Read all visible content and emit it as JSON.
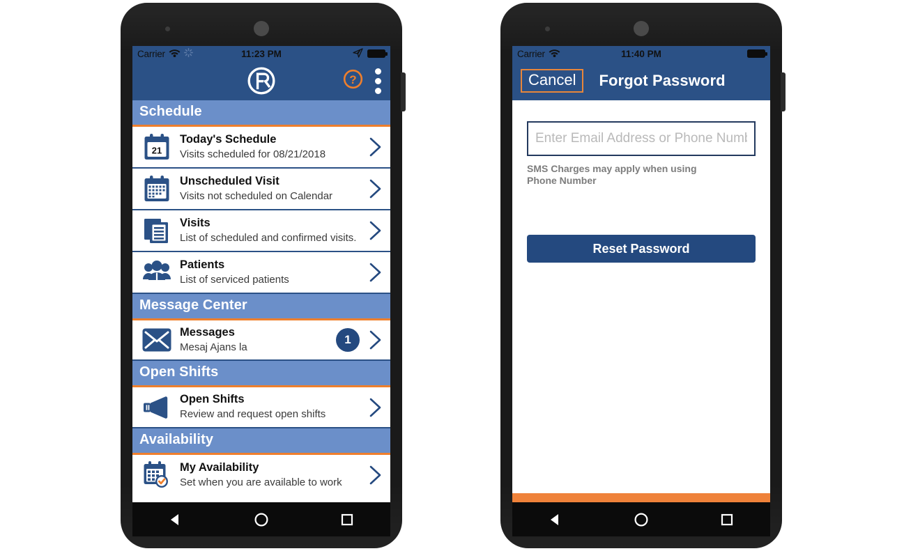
{
  "meta": {
    "colors": {
      "brand_blue": "#2b5186",
      "section_blue": "#6b8fc9",
      "accent_orange": "#ef7f2c",
      "button_blue": "#24497f",
      "screen_white": "#ffffff",
      "phone_body": "#1a1a1a"
    }
  },
  "phone_left": {
    "status_bar": {
      "carrier": "Carrier",
      "time": "11:23 PM",
      "wifi_icon": "wifi-icon",
      "sync_icon": "sync-spinner-icon",
      "location_icon": "location-arrow-icon",
      "battery_icon": "battery-full-icon"
    },
    "app_bar": {
      "logo_icon": "r-circle-logo-icon",
      "help_icon": "help-question-icon",
      "overflow_icon": "overflow-menu-icon"
    },
    "sections": [
      {
        "header": "Schedule",
        "rows": [
          {
            "icon": "calendar-day-21-icon",
            "title": "Today's Schedule",
            "subtitle": "Visits scheduled for 08/21/2018",
            "badge": null,
            "day": "21"
          },
          {
            "icon": "calendar-grid-icon",
            "title": "Unscheduled Visit",
            "subtitle": "Visits not scheduled on Calendar",
            "badge": null
          },
          {
            "icon": "documents-list-icon",
            "title": "Visits",
            "subtitle": "List of scheduled and confirmed visits.",
            "badge": null
          },
          {
            "icon": "people-group-icon",
            "title": "Patients",
            "subtitle": "List of serviced patients",
            "badge": null
          }
        ]
      },
      {
        "header": "Message Center",
        "rows": [
          {
            "icon": "envelope-icon",
            "title": "Messages",
            "subtitle": "Mesaj Ajans la",
            "badge": "1"
          }
        ]
      },
      {
        "header": "Open Shifts",
        "rows": [
          {
            "icon": "megaphone-icon",
            "title": "Open Shifts",
            "subtitle": "Review and request open shifts",
            "badge": null
          }
        ]
      },
      {
        "header": "Availability",
        "rows": [
          {
            "icon": "calendar-check-icon",
            "title": "My Availability",
            "subtitle": "Set when you are available to work",
            "badge": null
          }
        ]
      }
    ],
    "android_nav": {
      "back_icon": "back-triangle-icon",
      "home_icon": "home-circle-icon",
      "recents_icon": "recents-square-icon"
    }
  },
  "phone_right": {
    "status_bar": {
      "carrier": "Carrier",
      "time": "11:40 PM",
      "wifi_icon": "wifi-icon",
      "battery_icon": "battery-full-icon"
    },
    "nav_bar": {
      "cancel_label": "Cancel",
      "title": "Forgot Password"
    },
    "form": {
      "email_placeholder": "Enter Email Address or Phone Number",
      "email_value": "",
      "sms_note": "SMS Charges may apply when using Phone Number",
      "reset_label": "Reset Password"
    },
    "android_nav": {
      "back_icon": "back-triangle-icon",
      "home_icon": "home-circle-icon",
      "recents_icon": "recents-square-icon"
    }
  }
}
